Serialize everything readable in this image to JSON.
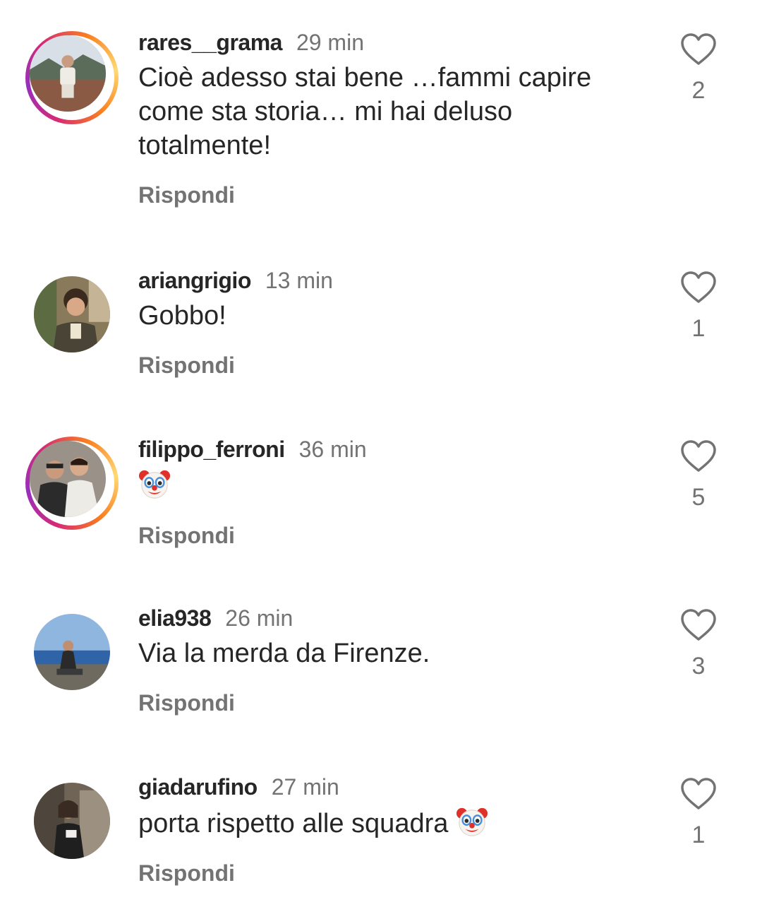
{
  "comments": [
    {
      "username": "rares__grama",
      "time": "29 min",
      "text": "Cioè adesso stai bene …fammi capire come sta storia… mi hai deluso totalmente!",
      "reply_label": "Rispondi",
      "likes": "2",
      "has_story": true,
      "avatar_icon": "avatar-photo",
      "emoji": ""
    },
    {
      "username": "ariangrigio",
      "time": "13 min",
      "text": "Gobbo!",
      "reply_label": "Rispondi",
      "likes": "1",
      "has_story": false,
      "avatar_icon": "avatar-photo",
      "emoji": ""
    },
    {
      "username": "filippo_ferroni",
      "time": "36 min",
      "text": "",
      "reply_label": "Rispondi",
      "likes": "5",
      "has_story": true,
      "avatar_icon": "avatar-photo",
      "emoji": "clown-face"
    },
    {
      "username": "elia938",
      "time": "26 min",
      "text": "Via la merda da Firenze.",
      "reply_label": "Rispondi",
      "likes": "3",
      "has_story": false,
      "avatar_icon": "avatar-photo",
      "emoji": ""
    },
    {
      "username": "giadarufino",
      "time": "27 min",
      "text": "porta rispetto alle squadra ",
      "reply_label": "Rispondi",
      "likes": "1",
      "has_story": false,
      "avatar_icon": "avatar-photo",
      "emoji": "clown-face"
    }
  ],
  "colors": {
    "text_primary": "#262626",
    "text_secondary": "#737373",
    "story_ring_start": "#d62976",
    "story_ring_end": "#feda75"
  }
}
